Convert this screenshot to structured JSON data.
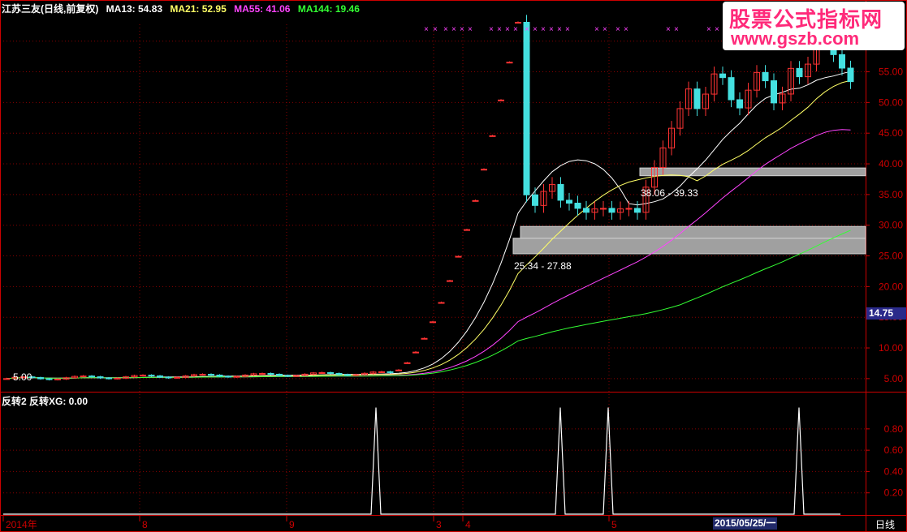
{
  "header": {
    "stock": "江苏三友(日线,前复权)",
    "ma": [
      {
        "label": "MA13: 54.83",
        "color": "#ffffff"
      },
      {
        "label": "MA21: 52.95",
        "color": "#ffff66"
      },
      {
        "label": "MA55: 41.06",
        "color": "#ff44ff"
      },
      {
        "label": "MA144: 19.46",
        "color": "#33ff33"
      }
    ]
  },
  "sub_header": "反转2  反转XG: 0.00",
  "watermark": {
    "line1": "股票公式指标网",
    "line2": "www.gszb.com"
  },
  "period_label": "日线",
  "cursor_date": "2015/05/25/一",
  "price_marker": "14.75",
  "colors": {
    "up": "#ff3333",
    "down": "#44e0e0",
    "axis": "#cc0000",
    "grid": "#880000"
  },
  "chart_data": [
    {
      "type": "candlestick",
      "title": "江苏三友(日线,前复权)",
      "ylim": [
        3,
        63
      ],
      "y_ticks": [
        "60.00",
        "55.00",
        "50.00",
        "45.00",
        "40.00",
        "35.00",
        "30.00",
        "25.00",
        "20.00",
        "15.00",
        "10.00",
        "5.00"
      ],
      "x_ticks": [
        "2014年",
        "8",
        "9",
        "3",
        "4",
        "5",
        "2015/05/25/一"
      ],
      "annotations": [
        "5.00",
        "25.34 - 27.88",
        "38.06 - 39.33"
      ],
      "zones": [
        {
          "low": 38.06,
          "high": 39.33
        },
        {
          "low": 25.34,
          "high": 27.88
        },
        {
          "low": 27.88,
          "high": 29.8
        }
      ],
      "series": [
        {
          "name": "MA13",
          "last": 54.83
        },
        {
          "name": "MA21",
          "last": 52.95
        },
        {
          "name": "MA55",
          "last": 41.06
        },
        {
          "name": "MA144",
          "last": 19.46
        }
      ]
    },
    {
      "type": "line",
      "title": "反转2",
      "ylim": [
        0,
        1.05
      ],
      "y_ticks": [
        "0.80",
        "0.60",
        "0.40",
        "0.20"
      ],
      "series": [
        {
          "name": "反转XG",
          "signal_days": [
            38,
            58,
            63,
            84
          ]
        }
      ]
    }
  ]
}
